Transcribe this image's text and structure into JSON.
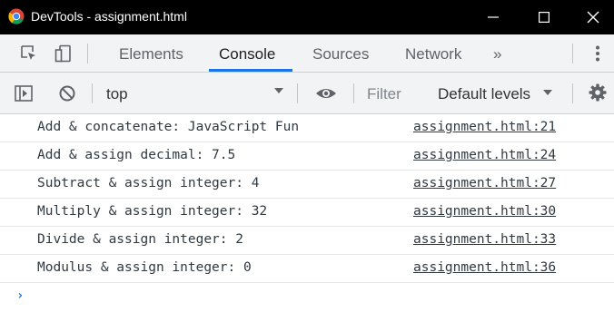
{
  "window": {
    "title": "DevTools - assignment.html",
    "minimize_label": "minimize",
    "maximize_label": "maximize",
    "close_label": "close"
  },
  "tabs": [
    {
      "label": "Elements",
      "active": false
    },
    {
      "label": "Console",
      "active": true
    },
    {
      "label": "Sources",
      "active": false
    },
    {
      "label": "Network",
      "active": false
    },
    {
      "label": "»",
      "active": false
    }
  ],
  "toolbar": {
    "context": "top",
    "filter_placeholder": "Filter",
    "levels": "Default levels"
  },
  "console": {
    "messages": [
      {
        "text": "Add & concatenate: JavaScript Fun",
        "source": "assignment.html:21"
      },
      {
        "text": "Add & assign decimal: 7.5",
        "source": "assignment.html:24"
      },
      {
        "text": "Subtract & assign integer: 4",
        "source": "assignment.html:27"
      },
      {
        "text": "Multiply & assign integer: 32",
        "source": "assignment.html:30"
      },
      {
        "text": "Divide & assign integer: 2",
        "source": "assignment.html:33"
      },
      {
        "text": "Modulus & assign integer: 0",
        "source": "assignment.html:36"
      }
    ],
    "prompt": "›"
  },
  "colors": {
    "accent": "#1a73e8",
    "titlebar": "#000000",
    "toolbar_bg": "#f1f3f4"
  }
}
